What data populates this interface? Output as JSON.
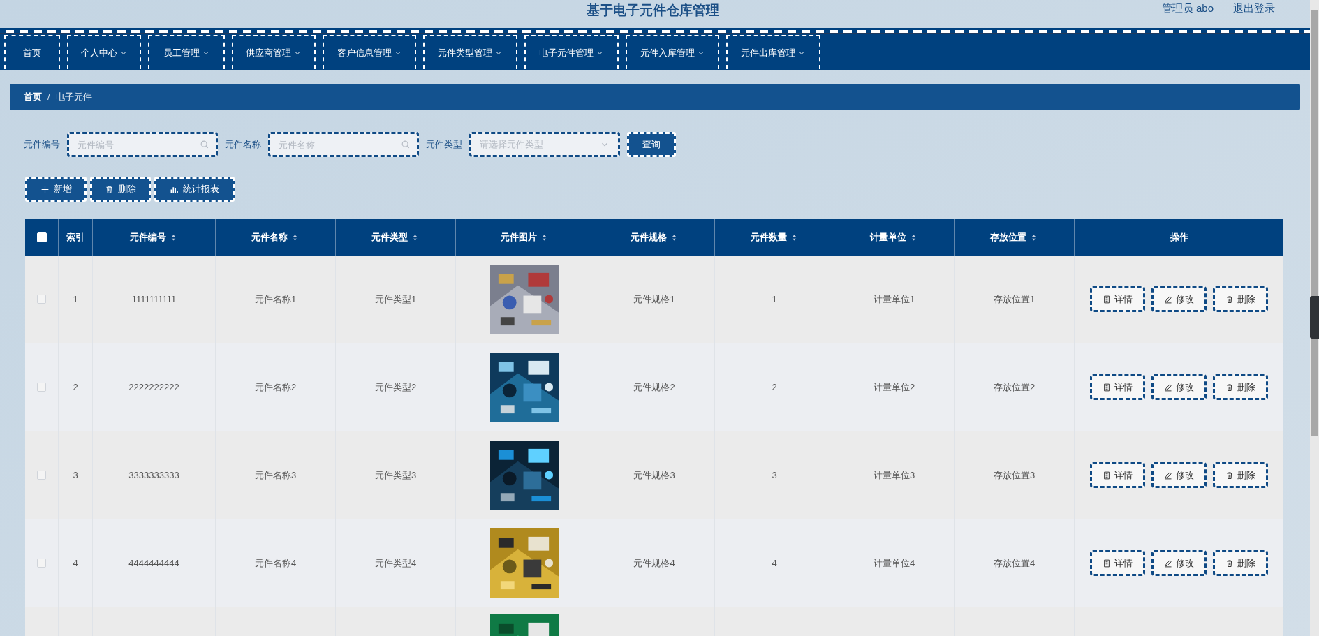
{
  "header": {
    "title": "基于电子元件仓库管理",
    "user": "管理员 abo",
    "logout": "退出登录"
  },
  "nav": [
    {
      "label": "首页",
      "dropdown": false
    },
    {
      "label": "个人中心",
      "dropdown": true
    },
    {
      "label": "员工管理",
      "dropdown": true
    },
    {
      "label": "供应商管理",
      "dropdown": true
    },
    {
      "label": "客户信息管理",
      "dropdown": true
    },
    {
      "label": "元件类型管理",
      "dropdown": true
    },
    {
      "label": "电子元件管理",
      "dropdown": true
    },
    {
      "label": "元件入库管理",
      "dropdown": true
    },
    {
      "label": "元件出库管理",
      "dropdown": true
    }
  ],
  "breadcrumb": {
    "separator": "/",
    "items": [
      {
        "label": "首页",
        "current": false
      },
      {
        "label": "电子元件",
        "current": true
      }
    ]
  },
  "search": {
    "fields": [
      {
        "label": "元件编号",
        "placeholder": "元件编号",
        "kind": "text"
      },
      {
        "label": "元件名称",
        "placeholder": "元件名称",
        "kind": "text"
      },
      {
        "label": "元件类型",
        "placeholder": "请选择元件类型",
        "kind": "select"
      }
    ],
    "button": "查询"
  },
  "actions": [
    {
      "label": "新增",
      "kind": "add"
    },
    {
      "label": "删除",
      "kind": "delete"
    },
    {
      "label": "统计报表",
      "kind": "report"
    }
  ],
  "table": {
    "select_all": {
      "checked": false
    },
    "columns": [
      {
        "label": "索引",
        "sortable": false
      },
      {
        "label": "元件编号",
        "sortable": true
      },
      {
        "label": "元件名称",
        "sortable": true
      },
      {
        "label": "元件类型",
        "sortable": true
      },
      {
        "label": "元件图片",
        "sortable": true
      },
      {
        "label": "元件规格",
        "sortable": true
      },
      {
        "label": "元件数量",
        "sortable": true
      },
      {
        "label": "计量单位",
        "sortable": true
      },
      {
        "label": "存放位置",
        "sortable": true
      },
      {
        "label": "操作",
        "sortable": false
      }
    ],
    "rows": [
      {
        "kind": "full",
        "checked": false,
        "cells": [
          "1",
          "1111111111",
          "元件名称1",
          "元件类型1",
          {
            "kind": "picture"
          },
          "元件规格1",
          "1",
          "计量单位1",
          "存放位置1"
        ],
        "actions": [
          {
            "label": "详情",
            "kind": "detail"
          },
          {
            "label": "修改",
            "kind": "edit"
          },
          {
            "label": "删除",
            "kind": "delete"
          }
        ]
      },
      {
        "kind": "full",
        "checked": false,
        "cells": [
          "2",
          "2222222222",
          "元件名称2",
          "元件类型2",
          {
            "kind": "picture"
          },
          "元件规格2",
          "2",
          "计量单位2",
          "存放位置2"
        ],
        "actions": [
          {
            "label": "详情",
            "kind": "detail"
          },
          {
            "label": "修改",
            "kind": "edit"
          },
          {
            "label": "删除",
            "kind": "delete"
          }
        ]
      },
      {
        "kind": "full",
        "checked": false,
        "cells": [
          "3",
          "3333333333",
          "元件名称3",
          "元件类型3",
          {
            "kind": "picture"
          },
          "元件规格3",
          "3",
          "计量单位3",
          "存放位置3"
        ],
        "actions": [
          {
            "label": "详情",
            "kind": "detail"
          },
          {
            "label": "修改",
            "kind": "edit"
          },
          {
            "label": "删除",
            "kind": "delete"
          }
        ]
      },
      {
        "kind": "full",
        "checked": false,
        "cells": [
          "4",
          "4444444444",
          "元件名称4",
          "元件类型4",
          {
            "kind": "picture"
          },
          "元件规格4",
          "4",
          "计量单位4",
          "存放位置4"
        ],
        "actions": [
          {
            "label": "详情",
            "kind": "detail"
          },
          {
            "label": "修改",
            "kind": "edit"
          },
          {
            "label": "删除",
            "kind": "delete"
          }
        ]
      },
      {
        "kind": "cut",
        "cells": [
          {
            "kind": "picture"
          }
        ]
      }
    ]
  }
}
